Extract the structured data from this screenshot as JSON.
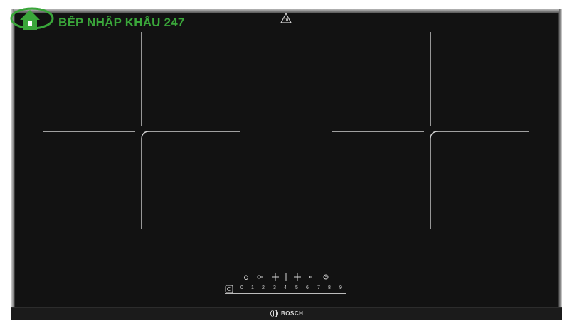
{
  "watermark": {
    "text": "BẾP NHẬP KHẨU 247",
    "icon": "house-logo-icon",
    "color": "#3aa63a"
  },
  "warning": {
    "icon": "hot-surface-warning-icon"
  },
  "controls": {
    "icons": [
      "child-lock-icon",
      "key-icon",
      "plus-left-icon",
      "separator-icon",
      "plus-right-icon",
      "dot-icon",
      "timer-icon"
    ],
    "power_icon": "power-icon",
    "levels": [
      "0",
      "1",
      "2",
      "3",
      "4",
      "5",
      "6",
      "7",
      "8",
      "9"
    ]
  },
  "brand": {
    "name": "BOSCH",
    "icon": "bosch-logo-icon"
  },
  "colors": {
    "surface": "#121212",
    "frame": "#9a9a9a",
    "zone_lines": "#d0d0d0"
  }
}
